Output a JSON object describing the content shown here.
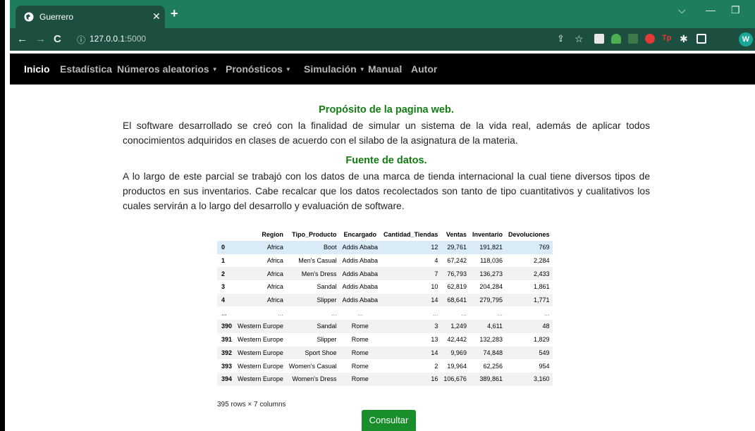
{
  "browser": {
    "tab_title": "Guerrero",
    "url_host": "127.0.0.1",
    "url_port": ":5000",
    "avatar_letter": "W"
  },
  "nav": {
    "items": [
      {
        "label": "Inicio",
        "active": true,
        "dropdown": false
      },
      {
        "label": "Estadística",
        "active": false,
        "dropdown": false
      },
      {
        "label": "Números aleatorios",
        "active": false,
        "dropdown": true
      },
      {
        "label": "Pronósticos",
        "active": false,
        "dropdown": true
      },
      {
        "label": "Simulación",
        "active": false,
        "dropdown": true
      },
      {
        "label": "Manual",
        "active": false,
        "dropdown": false
      },
      {
        "label": "Autor",
        "active": false,
        "dropdown": false
      }
    ]
  },
  "section1": {
    "heading": "Propósito de la pagina web.",
    "text": "El software desarrollado se creó con la finalidad de simular un sistema de la vida real, además de aplicar todos conocimientos adquiridos en clases de acuerdo con el silabo de la asignatura de la materia."
  },
  "section2": {
    "heading": "Fuente de datos.",
    "text": "A lo largo de este parcial se trabajó con los datos de una marca de tienda internacional la cual tiene diversos tipos de productos en sus inventarios. Cabe recalcar que los datos recolectados son tanto de tipo cuantitativos y cualitativos los cuales servirán a lo largo del desarrollo y evaluación de software."
  },
  "table": {
    "columns": [
      "",
      "Region",
      "Tipo_Producto",
      "Encargado",
      "Cantidad_Tiendas",
      "Ventas",
      "Inventario",
      "Devoluciones"
    ],
    "rows": [
      [
        "0",
        "Africa",
        "Boot",
        "Addis Ababa",
        "12",
        "29,761",
        "191,821",
        "769"
      ],
      [
        "1",
        "Africa",
        "Men's Casual",
        "Addis Ababa",
        "4",
        "67,242",
        "118,036",
        "2,284"
      ],
      [
        "2",
        "Africa",
        "Men's Dress",
        "Addis Ababa",
        "7",
        "76,793",
        "136,273",
        "2,433"
      ],
      [
        "3",
        "Africa",
        "Sandal",
        "Addis Ababa",
        "10",
        "62,819",
        "204,284",
        "1,861"
      ],
      [
        "4",
        "Africa",
        "Slipper",
        "Addis Ababa",
        "14",
        "68,641",
        "279,795",
        "1,771"
      ],
      [
        "...",
        "...",
        "...",
        "...",
        "...",
        "...",
        "...",
        "..."
      ],
      [
        "390",
        "Western Europe",
        "Sandal",
        "Rome",
        "3",
        "1,249",
        "4,611",
        "48"
      ],
      [
        "391",
        "Western Europe",
        "Slipper",
        "Rome",
        "13",
        "42,442",
        "132,283",
        "1,829"
      ],
      [
        "392",
        "Western Europe",
        "Sport Shoe",
        "Rome",
        "14",
        "9,969",
        "74,848",
        "549"
      ],
      [
        "393",
        "Western Europe",
        "Women's Casual",
        "Rome",
        "2",
        "19,964",
        "62,256",
        "954"
      ],
      [
        "394",
        "Western Europe",
        "Women's Dress",
        "Rome",
        "16",
        "106,676",
        "389,861",
        "3,160"
      ]
    ],
    "dimensions": "395 rows × 7 columns"
  },
  "consult_button": "Consultar",
  "colors": {
    "tab_strip": "#1e7d5c",
    "toolbar": "#1c4f3f",
    "heading_green": "#137c13",
    "button_green": "#198f2c"
  }
}
